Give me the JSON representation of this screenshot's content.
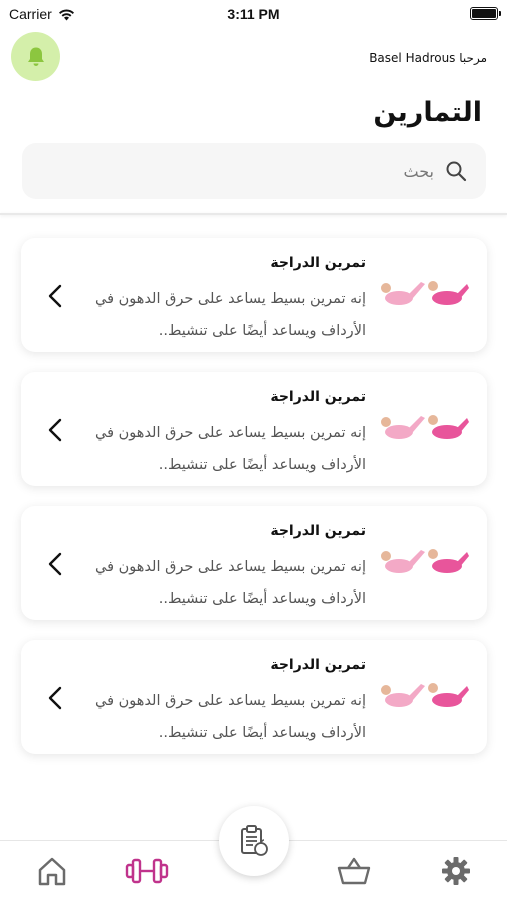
{
  "status_bar": {
    "carrier": "Carrier",
    "time": "3:11 PM"
  },
  "header": {
    "greeting": "مرحبا Basel Hadrous",
    "title": "التمارين"
  },
  "search": {
    "placeholder": "بحث",
    "value": ""
  },
  "exercises": [
    {
      "title": "تمرين الدراجة",
      "description": "إنه تمرين بسيط يساعد على حرق الدهون في الأرداف ويساعد أيضًا على تنشيط..",
      "thumbnail": "bicycle-crunch-illustration"
    },
    {
      "title": "تمرين الدراجة",
      "description": "إنه تمرين بسيط يساعد على حرق الدهون في الأرداف ويساعد أيضًا على تنشيط..",
      "thumbnail": "bicycle-crunch-illustration"
    },
    {
      "title": "تمرين الدراجة",
      "description": "إنه تمرين بسيط يساعد على حرق الدهون في الأرداف ويساعد أيضًا على تنشيط..",
      "thumbnail": "bicycle-crunch-illustration"
    },
    {
      "title": "تمرين الدراجة",
      "description": "إنه تمرين بسيط يساعد على حرق الدهون في الأرداف ويساعد أيضًا على تنشيط..",
      "thumbnail": "bicycle-crunch-illustration"
    }
  ],
  "tab_bar": {
    "tabs": [
      {
        "icon": "home-icon",
        "active": false
      },
      {
        "icon": "dumbbell-icon",
        "active": true
      },
      {
        "icon": "basket-icon",
        "active": false
      },
      {
        "icon": "settings-gear-icon",
        "active": false
      }
    ],
    "center_button_icon": "clipboard-apple-icon"
  },
  "colors": {
    "accent": "#c0338c",
    "bell_background": "#d4efaa",
    "bell_icon": "#8cc63f",
    "inactive_icon": "#6b6b6b",
    "thumbnail_pink": "#e8559b",
    "thumbnail_light_pink": "#f3a9c6"
  }
}
